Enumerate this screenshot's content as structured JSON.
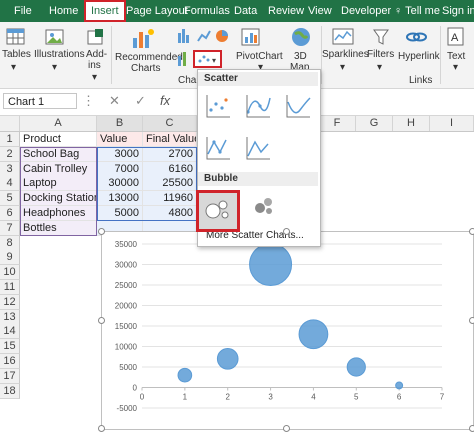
{
  "ribbon_tabs": [
    "File",
    "Home",
    "Insert",
    "Page Layout",
    "Formulas",
    "Data",
    "Review",
    "View",
    "Developer"
  ],
  "tell_me": "Tell me",
  "sign_in": "Sign in",
  "ribbon": {
    "tables": "Tables",
    "illustrations": "Illustrations",
    "addins_1": "Add-",
    "addins_2": "ins",
    "recommended_1": "Recommended",
    "recommended_2": "Charts",
    "charts_group": "Char",
    "pivotchart": "PivotChart",
    "map3d_1": "3D",
    "map3d_2": "Map",
    "sparklines": "Sparklines",
    "filters": "Filters",
    "hyperlink": "Hyperlink",
    "links_group": "Links",
    "text": "Text"
  },
  "formula_bar": {
    "name_box": "Chart 1",
    "cancel": "✕",
    "enter": "✓",
    "fx": "fx"
  },
  "columns": [
    "A",
    "B",
    "C",
    "F",
    "G",
    "H",
    "I"
  ],
  "rows": [
    "1",
    "2",
    "3",
    "4",
    "5",
    "6",
    "7",
    "8",
    "9",
    "10",
    "11",
    "12",
    "13",
    "14",
    "15",
    "16",
    "17",
    "18"
  ],
  "table": {
    "headers": [
      "Product",
      "Value",
      "Final Value"
    ],
    "data": [
      [
        "School Bag",
        "3000",
        "2700"
      ],
      [
        "Cabin Trolley",
        "7000",
        "6160"
      ],
      [
        "Laptop",
        "30000",
        "25500"
      ],
      [
        "Docking Station",
        "13000",
        "11960"
      ],
      [
        "Headphones",
        "5000",
        "4800"
      ],
      [
        "Bottles",
        "",
        ""
      ]
    ]
  },
  "dropdown": {
    "scatter_header": "Scatter",
    "bubble_header": "Bubble",
    "more": "More Scatter Charts..."
  },
  "colors": {
    "excel_green": "#217346",
    "highlight_red": "#d0232a",
    "bubble_blue": "#5b9bd5"
  },
  "chart_data": {
    "type": "scatter",
    "variant": "bubble",
    "x": [
      1,
      2,
      3,
      4,
      5,
      6
    ],
    "y": [
      3000,
      7000,
      30000,
      13000,
      5000,
      500
    ],
    "sizes": [
      2700,
      6160,
      25500,
      11960,
      4800,
      700
    ],
    "xlim": [
      0,
      7
    ],
    "ylim": [
      -5000,
      35000
    ],
    "x_ticks": [
      "0",
      "1",
      "2",
      "3",
      "4",
      "5",
      "6",
      "7"
    ],
    "y_ticks": [
      "35000",
      "30000",
      "25000",
      "20000",
      "15000",
      "10000",
      "5000",
      "0",
      "-5000"
    ],
    "grid": true
  }
}
